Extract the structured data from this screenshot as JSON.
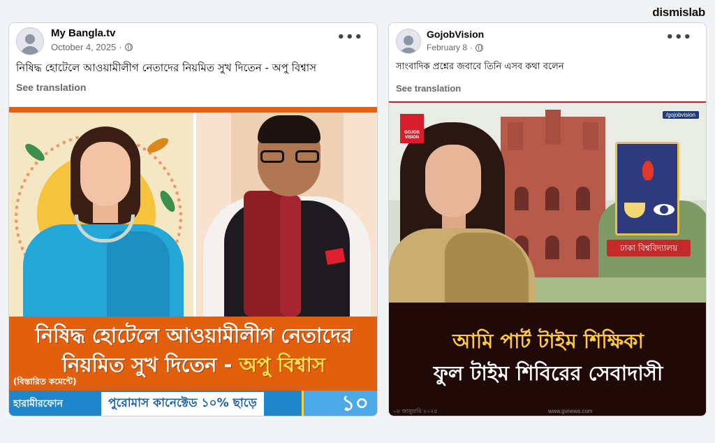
{
  "brand": "dismislab",
  "posts": [
    {
      "page_name": "My Bangla.tv",
      "date": "October 4, 2025",
      "caption": "নিষিদ্ধ হোটেলে আওয়ামীলীগ নেতাদের নিয়মিত সুখ দিতেন - অপু বিশ্বাস",
      "see_translation": "See translation",
      "image": {
        "banner_line1": "নিষিদ্ধ হোটেলে আওয়ামীলীগ নেতাদের",
        "banner_line2_prefix": "নিয়মিত সুখ দিতেন - ",
        "banner_line2_highlight": "অপু বিশ্বাস",
        "comment_tag": "(বিস্তারিত কমেন্টে)",
        "ad_logo": "হারামীরফোন",
        "ad_text": "পুরোমাস কানেক্টেড ১০% ছাড়ে",
        "ad_big": "১০"
      }
    },
    {
      "page_name": "GojobVision",
      "date": "February 8",
      "caption": "সাংবাদিক প্রশ্নের জবাবে তিনি এসব কথা বলেন",
      "see_translation": "See translation",
      "image": {
        "logo_text": "GOJOB VISION",
        "handle": "/gojobvision",
        "crest_ribbon": "ঢাকা বিশ্ববিদ্যালয়",
        "banner_line1": "আমি পার্ট টাইম শিক্ষিকা",
        "banner_line2": "ফুল টাইম শিবিরের সেবাদাসী",
        "footer_left": "০৮ জানুয়ারি ২০২৫",
        "footer_center": "www.gvnews.com"
      }
    }
  ],
  "colors": {
    "banner1": "#e25f0e",
    "highlight": "#ffe14d",
    "banner2": "#200a08",
    "banner2_line1": "#ffc93c"
  }
}
